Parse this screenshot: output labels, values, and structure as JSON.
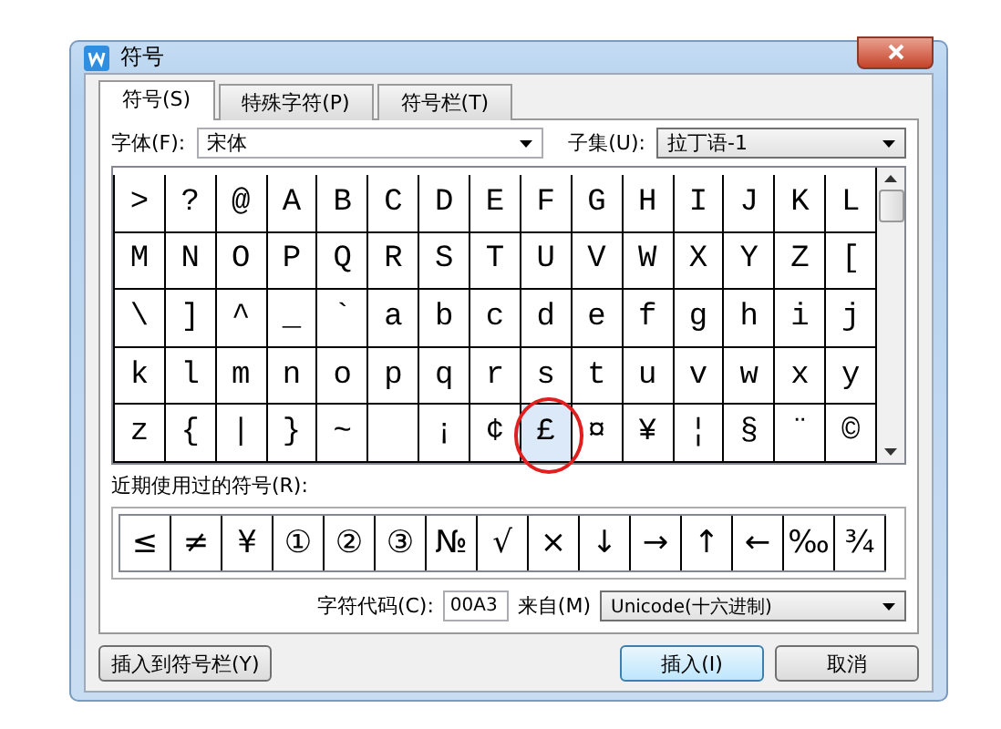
{
  "window": {
    "title": "符号"
  },
  "tabs": [
    {
      "label": "符号(S)",
      "selected": true
    },
    {
      "label": "特殊字符(P)",
      "selected": false
    },
    {
      "label": "符号栏(T)",
      "selected": false
    }
  ],
  "font": {
    "label": "字体(F):",
    "value": "宋体"
  },
  "subset": {
    "label": "子集(U):",
    "value": "拉丁语-1"
  },
  "symbols": [
    {
      "char": ">",
      "selected": false
    },
    {
      "char": "?",
      "selected": false
    },
    {
      "char": "@",
      "selected": false
    },
    {
      "char": "A",
      "selected": false
    },
    {
      "char": "B",
      "selected": false
    },
    {
      "char": "C",
      "selected": false
    },
    {
      "char": "D",
      "selected": false
    },
    {
      "char": "E",
      "selected": false
    },
    {
      "char": "F",
      "selected": false
    },
    {
      "char": "G",
      "selected": false
    },
    {
      "char": "H",
      "selected": false
    },
    {
      "char": "I",
      "selected": false
    },
    {
      "char": "J",
      "selected": false
    },
    {
      "char": "K",
      "selected": false
    },
    {
      "char": "L",
      "selected": false
    },
    {
      "char": "M",
      "selected": false
    },
    {
      "char": "N",
      "selected": false
    },
    {
      "char": "O",
      "selected": false
    },
    {
      "char": "P",
      "selected": false
    },
    {
      "char": "Q",
      "selected": false
    },
    {
      "char": "R",
      "selected": false
    },
    {
      "char": "S",
      "selected": false
    },
    {
      "char": "T",
      "selected": false
    },
    {
      "char": "U",
      "selected": false
    },
    {
      "char": "V",
      "selected": false
    },
    {
      "char": "W",
      "selected": false
    },
    {
      "char": "X",
      "selected": false
    },
    {
      "char": "Y",
      "selected": false
    },
    {
      "char": "Z",
      "selected": false
    },
    {
      "char": "[",
      "selected": false
    },
    {
      "char": "\\",
      "selected": false
    },
    {
      "char": "]",
      "selected": false
    },
    {
      "char": "^",
      "selected": false
    },
    {
      "char": "_",
      "selected": false
    },
    {
      "char": "`",
      "selected": false
    },
    {
      "char": "a",
      "selected": false
    },
    {
      "char": "b",
      "selected": false
    },
    {
      "char": "c",
      "selected": false
    },
    {
      "char": "d",
      "selected": false
    },
    {
      "char": "e",
      "selected": false
    },
    {
      "char": "f",
      "selected": false
    },
    {
      "char": "g",
      "selected": false
    },
    {
      "char": "h",
      "selected": false
    },
    {
      "char": "i",
      "selected": false
    },
    {
      "char": "j",
      "selected": false
    },
    {
      "char": "k",
      "selected": false
    },
    {
      "char": "l",
      "selected": false
    },
    {
      "char": "m",
      "selected": false
    },
    {
      "char": "n",
      "selected": false
    },
    {
      "char": "o",
      "selected": false
    },
    {
      "char": "p",
      "selected": false
    },
    {
      "char": "q",
      "selected": false
    },
    {
      "char": "r",
      "selected": false
    },
    {
      "char": "s",
      "selected": false
    },
    {
      "char": "t",
      "selected": false
    },
    {
      "char": "u",
      "selected": false
    },
    {
      "char": "v",
      "selected": false
    },
    {
      "char": "w",
      "selected": false
    },
    {
      "char": "x",
      "selected": false
    },
    {
      "char": "y",
      "selected": false
    },
    {
      "char": "z",
      "selected": false
    },
    {
      "char": "{",
      "selected": false
    },
    {
      "char": "|",
      "selected": false
    },
    {
      "char": "}",
      "selected": false
    },
    {
      "char": "~",
      "selected": false
    },
    {
      "selected": false
    },
    {
      "char": "¡",
      "selected": false
    },
    {
      "char": "¢",
      "selected": false
    },
    {
      "char": "£",
      "selected": true
    },
    {
      "char": "¤",
      "selected": false
    },
    {
      "char": "¥",
      "selected": false
    },
    {
      "char": "¦",
      "selected": false
    },
    {
      "char": "§",
      "selected": false
    },
    {
      "char": "¨",
      "selected": false
    },
    {
      "char": "©",
      "selected": false
    }
  ],
  "recent": {
    "label": "近期使用过的符号(R):",
    "symbols": [
      "≤",
      "≠",
      "¥",
      "①",
      "②",
      "③",
      "№",
      "√",
      "×",
      "↓",
      "→",
      "↑",
      "←",
      "‰",
      "¾"
    ]
  },
  "char_code": {
    "label": "字符代码(C):",
    "value": "00A3"
  },
  "from": {
    "label": "来自(M)",
    "value": "Unicode(十六进制)"
  },
  "buttons": {
    "add_to_bar": "插入到符号栏(Y)",
    "insert": "插入(I)",
    "cancel": "取消"
  }
}
